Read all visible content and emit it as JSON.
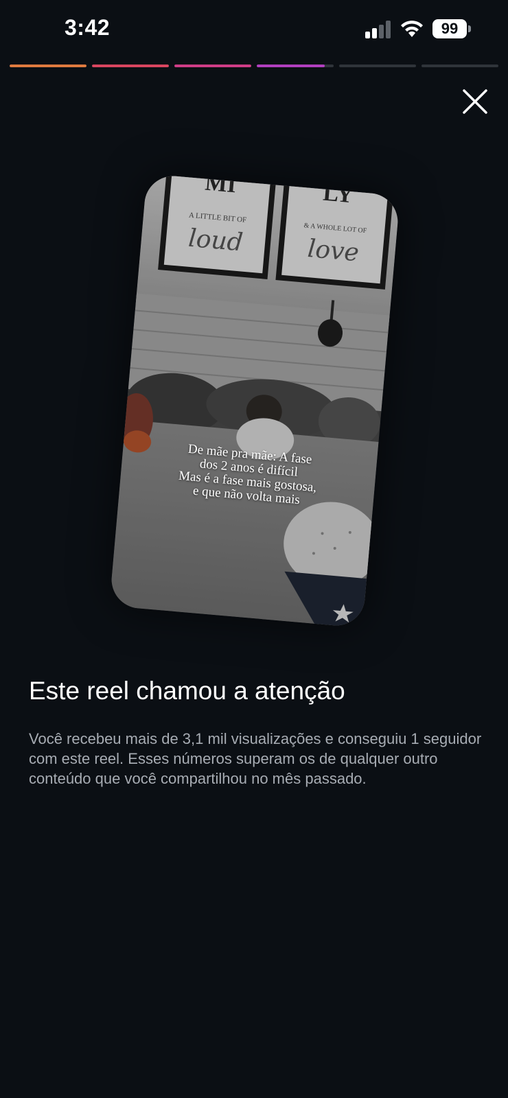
{
  "status_bar": {
    "time": "3:42",
    "battery_level": "99",
    "signal_icon": "cellular-signal-icon",
    "wifi_icon": "wifi-icon"
  },
  "progress": {
    "segments": [
      {
        "state": "complete",
        "fill": 1.0,
        "color": "#e07a3f"
      },
      {
        "state": "complete",
        "fill": 1.0,
        "color": "#d9455f"
      },
      {
        "state": "complete",
        "fill": 1.0,
        "color": "#cf3d86"
      },
      {
        "state": "current",
        "fill": 0.88,
        "color": "#b13fbf"
      },
      {
        "state": "upcoming",
        "fill": 0.0,
        "color": "#2f343a"
      },
      {
        "state": "upcoming",
        "fill": 0.0,
        "color": "#2f343a"
      }
    ]
  },
  "close_icon": "close-icon",
  "reel": {
    "poster_left_top": "A LITTLE BIT OF",
    "poster_left_script": "loud",
    "poster_right_top": "& A WHOLE LOT OF",
    "poster_right_script": "love",
    "overlay_lines": [
      "De mãe pra mãe: A fase",
      "dos 2 anos é difícil",
      "Mas é a fase mais gostosa,",
      "e que não volta mais"
    ]
  },
  "content": {
    "headline": "Este reel chamou a atenção",
    "description": "Você recebeu mais de 3,1 mil visualizações e conseguiu 1 seguidor com este reel. Esses números superam os de qualquer outro conteúdo que você compartilhou no mês passado."
  },
  "colors": {
    "background": "#0b0f14",
    "headline": "#ffffff",
    "description": "#a7acb3"
  }
}
